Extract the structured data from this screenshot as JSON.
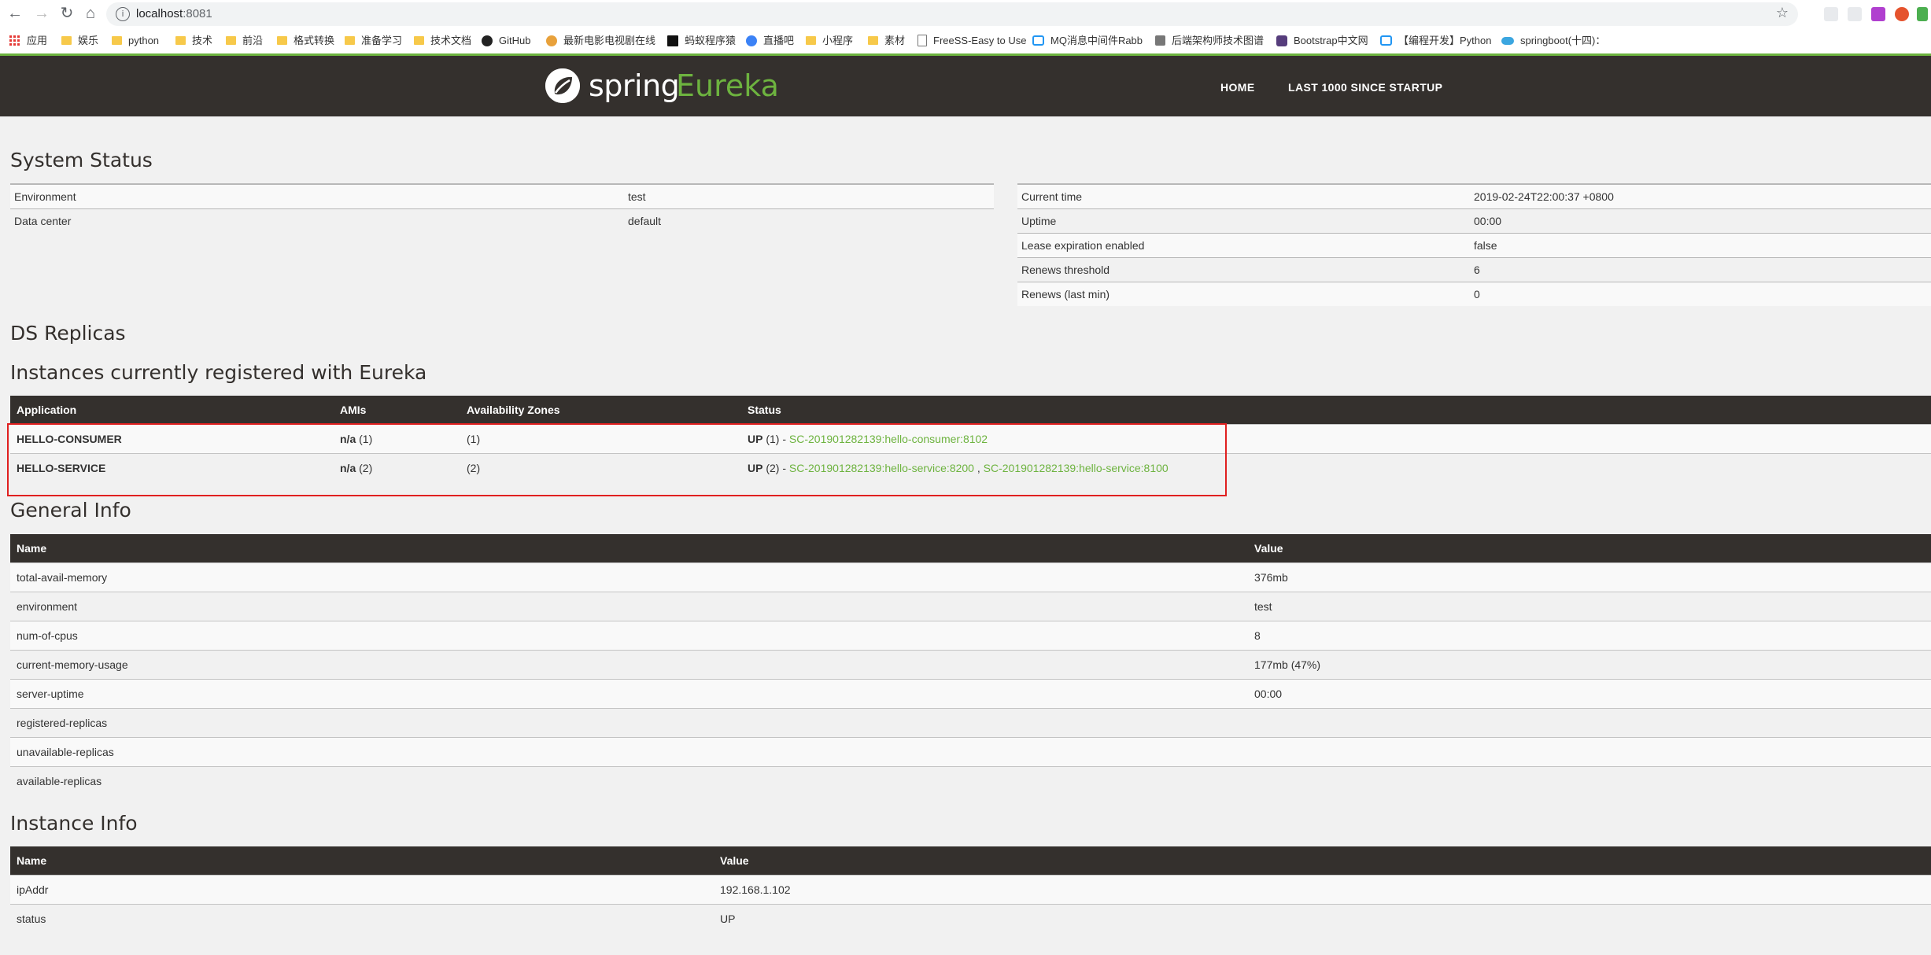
{
  "browser": {
    "url_host": "localhost",
    "url_port": ":8081",
    "bookmarks": [
      {
        "label": "应用",
        "icon": "apps-grid-icon"
      },
      {
        "label": "娱乐",
        "icon": "folder-icon"
      },
      {
        "label": "python",
        "icon": "folder-icon"
      },
      {
        "label": "技术",
        "icon": "folder-icon"
      },
      {
        "label": "前沿",
        "icon": "folder-icon"
      },
      {
        "label": "格式转换",
        "icon": "folder-icon"
      },
      {
        "label": "准备学习",
        "icon": "folder-icon"
      },
      {
        "label": "技术文档",
        "icon": "folder-icon"
      },
      {
        "label": "GitHub",
        "icon": "github-icon"
      },
      {
        "label": "最新电影电视剧在线",
        "icon": "site-icon"
      },
      {
        "label": "蚂蚁程序猿",
        "icon": "site-icon"
      },
      {
        "label": "直播吧",
        "icon": "site-icon"
      },
      {
        "label": "小程序",
        "icon": "folder-icon"
      },
      {
        "label": "素材",
        "icon": "folder-icon"
      },
      {
        "label": "FreeSS-Easy to Use",
        "icon": "page-icon"
      },
      {
        "label": "MQ消息中间件Rabb",
        "icon": "site-icon"
      },
      {
        "label": "后端架构师技术图谱",
        "icon": "site-icon"
      },
      {
        "label": "Bootstrap中文网",
        "icon": "bootstrap-icon"
      },
      {
        "label": "【编程开发】Python",
        "icon": "site-icon"
      },
      {
        "label": "springboot(十四)：",
        "icon": "cloud-icon"
      }
    ]
  },
  "nav": {
    "logo_spring": "spring",
    "logo_eureka": "Eureka",
    "home": "HOME",
    "last1000": "LAST 1000 SINCE STARTUP"
  },
  "system_status": {
    "title": "System Status",
    "left": [
      {
        "k": "Environment",
        "v": "test"
      },
      {
        "k": "Data center",
        "v": "default"
      }
    ],
    "right": [
      {
        "k": "Current time",
        "v": "2019-02-24T22:00:37 +0800"
      },
      {
        "k": "Uptime",
        "v": "00:00"
      },
      {
        "k": "Lease expiration enabled",
        "v": "false"
      },
      {
        "k": "Renews threshold",
        "v": "6"
      },
      {
        "k": "Renews (last min)",
        "v": "0"
      }
    ]
  },
  "ds_replicas": {
    "title": "DS Replicas"
  },
  "instances": {
    "title": "Instances currently registered with Eureka",
    "headers": {
      "application": "Application",
      "amis": "AMIs",
      "zones": "Availability Zones",
      "status": "Status"
    },
    "rows": [
      {
        "application": "HELLO-CONSUMER",
        "amis_label": "n/a",
        "amis_count": "(1)",
        "zones": "(1)",
        "status": "UP",
        "status_count": "(1) -",
        "links": [
          "SC-201901282139:hello-consumer:8102"
        ]
      },
      {
        "application": "HELLO-SERVICE",
        "amis_label": "n/a",
        "amis_count": "(2)",
        "zones": "(2)",
        "status": "UP",
        "status_count": "(2) -",
        "links": [
          "SC-201901282139:hello-service:8200",
          "SC-201901282139:hello-service:8100"
        ],
        "link_sep": " , "
      }
    ]
  },
  "general_info": {
    "title": "General Info",
    "headers": {
      "name": "Name",
      "value": "Value"
    },
    "rows": [
      {
        "k": "total-avail-memory",
        "v": "376mb"
      },
      {
        "k": "environment",
        "v": "test"
      },
      {
        "k": "num-of-cpus",
        "v": "8"
      },
      {
        "k": "current-memory-usage",
        "v": "177mb (47%)"
      },
      {
        "k": "server-uptime",
        "v": "00:00"
      },
      {
        "k": "registered-replicas",
        "v": ""
      },
      {
        "k": "unavailable-replicas",
        "v": ""
      },
      {
        "k": "available-replicas",
        "v": ""
      }
    ]
  },
  "instance_info": {
    "title": "Instance Info",
    "headers": {
      "name": "Name",
      "value": "Value"
    },
    "rows": [
      {
        "k": "ipAddr",
        "v": "192.168.1.102"
      },
      {
        "k": "status",
        "v": "UP"
      }
    ]
  },
  "colors": {
    "accent": "#6db33f",
    "navbar": "#34302d",
    "highlight": "#e02020"
  }
}
